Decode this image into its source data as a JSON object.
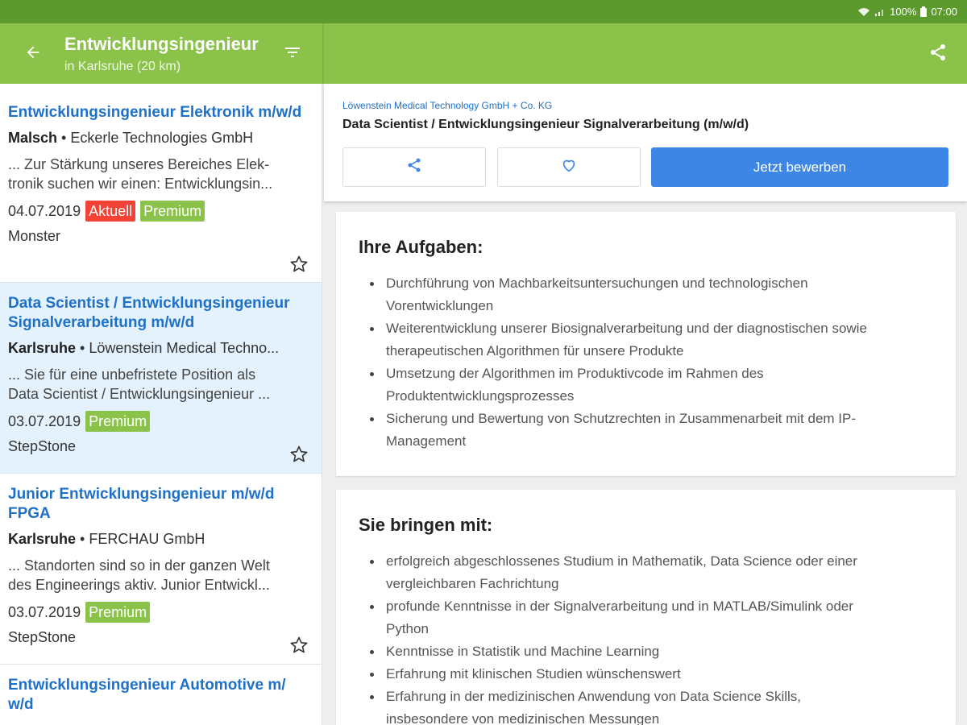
{
  "status_bar": {
    "battery": "100%",
    "time": "07:00"
  },
  "app_bar": {
    "title": "Entwicklungsingenieur",
    "subtitle": "in Karlsruhe (20 km)"
  },
  "jobs": [
    {
      "title": "Entwicklungsingenieur Elektronik m/w/d",
      "location": "Malsch",
      "company": "Eckerle Technologies GmbH",
      "snippet_line1": "... Zur Stärkung unseres Bereiches Elek-",
      "snippet_line2": "tronik suchen wir einen: Entwicklungsin...",
      "date": "04.07.2019",
      "badge_current": "Aktuell",
      "badge_premium": "Premium",
      "source": "Monster"
    },
    {
      "title": "Data Scientist / Entwicklungsingenieur Signalverarbeitung m/w/d",
      "location": "Karlsruhe",
      "company": "Löwenstein Medical Techno...",
      "snippet_line1": "... Sie für eine unbefristete Position als",
      "snippet_line2": "Data Scientist / Entwicklungsingenieur ...",
      "date": "03.07.2019",
      "badge_premium": "Premium",
      "source": "StepStone"
    },
    {
      "title": "Junior Entwicklungsingenieur m/w/d FPGA",
      "location": "Karlsruhe",
      "company": "FERCHAU GmbH",
      "snippet_line1": "... Standorten sind so in der ganzen Welt",
      "snippet_line2": "des Engineerings aktiv. Junior Entwickl...",
      "date": "03.07.2019",
      "badge_premium": "Premium",
      "source": "StepStone"
    },
    {
      "title": "Entwicklungsingenieur Automotive m/ w/d"
    }
  ],
  "detail": {
    "company": "Löwenstein Medical Technology GmbH + Co. KG",
    "title": "Data Scientist / Entwicklungsingenieur Signalverarbeitung (m/w/d)",
    "apply_label": "Jetzt bewerben"
  },
  "sections": [
    {
      "heading": "Ihre Aufgaben:",
      "items": [
        [
          "Durchführung von Machbarkeitsuntersuchungen und technologischen",
          "Vorentwicklungen"
        ],
        [
          "Weiterentwicklung unserer Biosignalverarbeitung und der diagnostischen sowie",
          "therapeutischen Algorithmen für unsere Produkte"
        ],
        [
          "Umsetzung der Algorithmen im Produktivcode im Rahmen des",
          "Produktentwicklungsprozesses"
        ],
        [
          "Sicherung und Bewertung von Schutzrechten in Zusammenarbeit mit dem IP-",
          "Management"
        ]
      ]
    },
    {
      "heading": "Sie bringen mit:",
      "items": [
        [
          "erfolgreich abgeschlossenes Studium in Mathematik, Data Science oder einer",
          "vergleichbaren Fachrichtung"
        ],
        [
          "profunde Kenntnisse in der Signalverarbeitung und in MATLAB/Simulink oder",
          "Python"
        ],
        [
          "Kenntnisse in Statistik und Machine Learning"
        ],
        [
          "Erfahrung mit klinischen Studien wünschenswert"
        ],
        [
          "Erfahrung in der medizinischen Anwendung von Data Science Skills,",
          "insbesondere von medizinischen Messungen"
        ]
      ]
    }
  ],
  "colors": {
    "status_bar": "#5c9a2e",
    "app_bar": "#8bc34a",
    "link_blue": "#1e70c8",
    "apply_button": "#3d86e6",
    "selected_row": "#e3f2fd",
    "badge_red": "#f44336",
    "badge_green": "#8bc34a"
  }
}
